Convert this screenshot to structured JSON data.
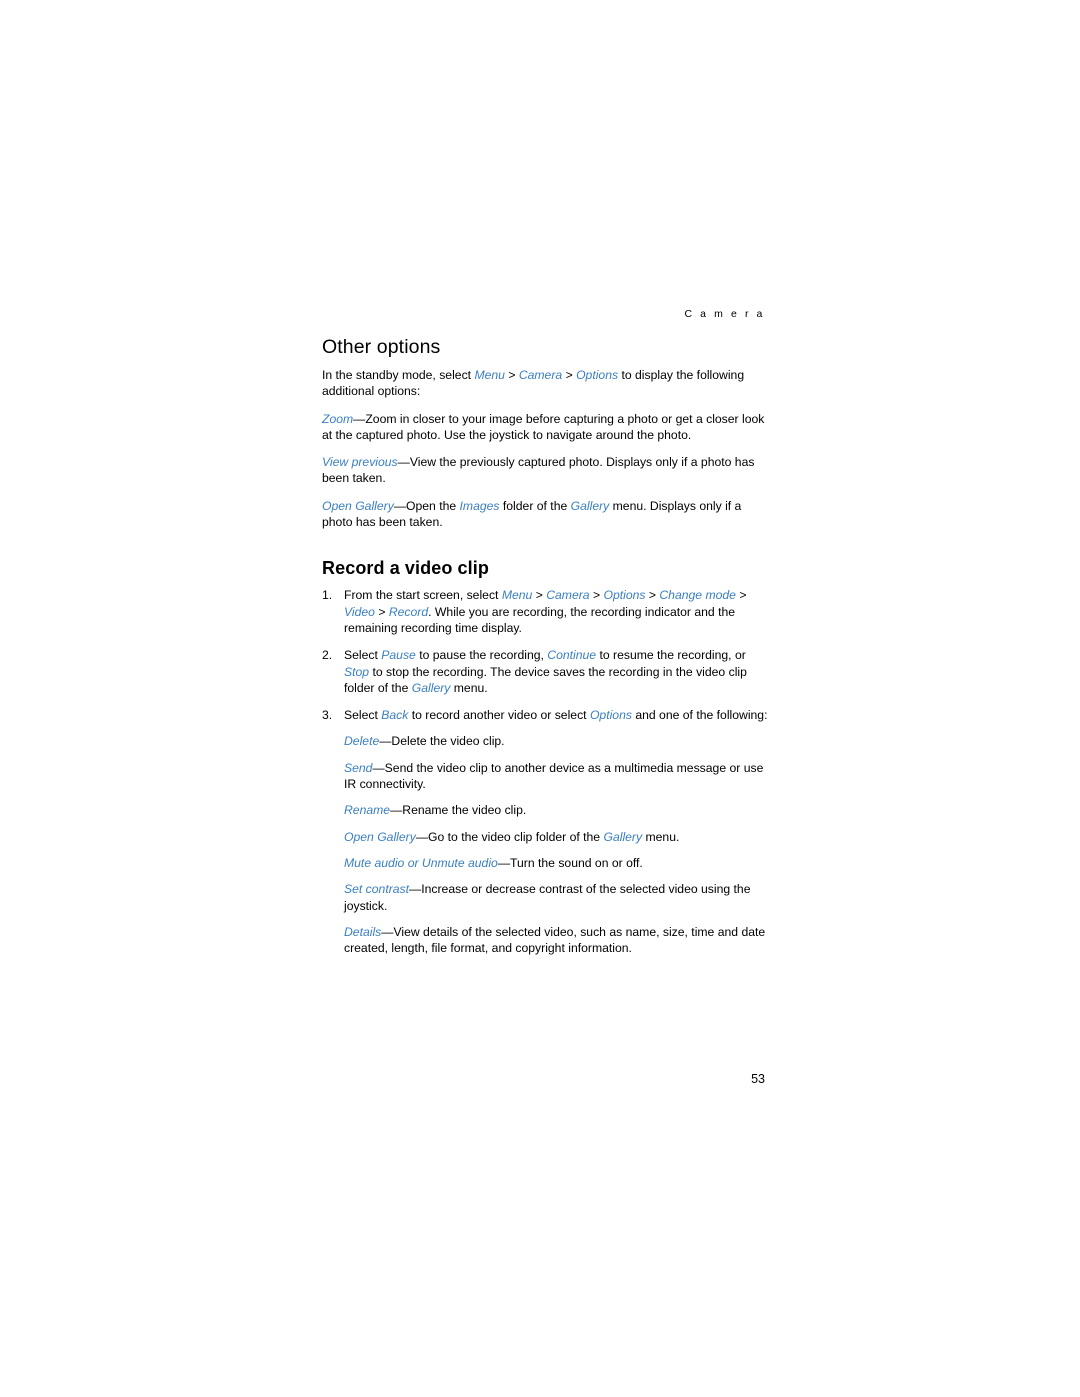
{
  "header": {
    "running_head": "C a m e r a"
  },
  "sections": [
    {
      "title": "Other options",
      "intro_1a": "In the standby mode, select ",
      "intro_menu": "Menu",
      "sep1": " > ",
      "intro_camera": "Camera",
      "sep2": " > ",
      "intro_options": "Options",
      "intro_1b": " to display the following additional options:",
      "p_zoom_term": "Zoom",
      "p_zoom_text": "—Zoom in closer to your image before capturing a photo or get a closer look at the captured photo. Use the joystick to navigate around the photo.",
      "p_viewprev_term": "View previous",
      "p_viewprev_text": "—View the previously captured photo. Displays only if a photo has been taken.",
      "p_opengallery_term": "Open Gallery",
      "p_opengallery_a": "—Open the ",
      "p_opengallery_images": "Images",
      "p_opengallery_b": " folder of the ",
      "p_opengallery_gallery": "Gallery",
      "p_opengallery_c": " menu. Displays only if a photo has been taken."
    }
  ],
  "record": {
    "title": "Record a video clip",
    "steps": [
      {
        "num": "1.",
        "a": "From the start screen, select ",
        "menu": "Menu",
        "s1": " > ",
        "camera": "Camera",
        "s2": " > ",
        "options": "Options",
        "s3": " > ",
        "changemode": "Change mode",
        "s4": " > ",
        "video": "Video",
        "s5": " > ",
        "record": "Record",
        "b": ". While you are recording, the recording indicator and the remaining recording time display."
      },
      {
        "num": "2.",
        "a": "Select ",
        "pause": "Pause",
        "b": " to pause the recording, ",
        "continue": "Continue",
        "c": " to resume the recording, or ",
        "stop": "Stop",
        "d": " to stop the recording. The device saves the recording in the video clip folder of the ",
        "gallery": "Gallery",
        "e": " menu."
      },
      {
        "num": "3.",
        "a": "Select ",
        "back": "Back",
        "b": " to record another video or select ",
        "options": "Options",
        "c": " and one of the following:"
      }
    ],
    "sub_items": [
      {
        "term": "Delete",
        "text": "—Delete the video clip."
      },
      {
        "term": "Send",
        "text": "—Send the video clip to another device as a multimedia message or use IR connectivity."
      },
      {
        "term": "Rename",
        "text": "—Rename the video clip."
      },
      {
        "term": "Open Gallery",
        "text_a": "—Go to the video clip folder of the ",
        "term2": "Gallery",
        "text_b": " menu."
      },
      {
        "term": "Mute audio",
        "mid": " or ",
        "term2": "Unmute audio",
        "text": "—Turn the sound on or off."
      },
      {
        "term": "Set contrast",
        "text": "—Increase or decrease contrast of the selected video using the joystick."
      },
      {
        "term": "Details",
        "text": "—View details of the selected video, such as name, size, time and date created, length, file format, and copyright information."
      }
    ]
  },
  "footer": {
    "page_number": "53"
  }
}
